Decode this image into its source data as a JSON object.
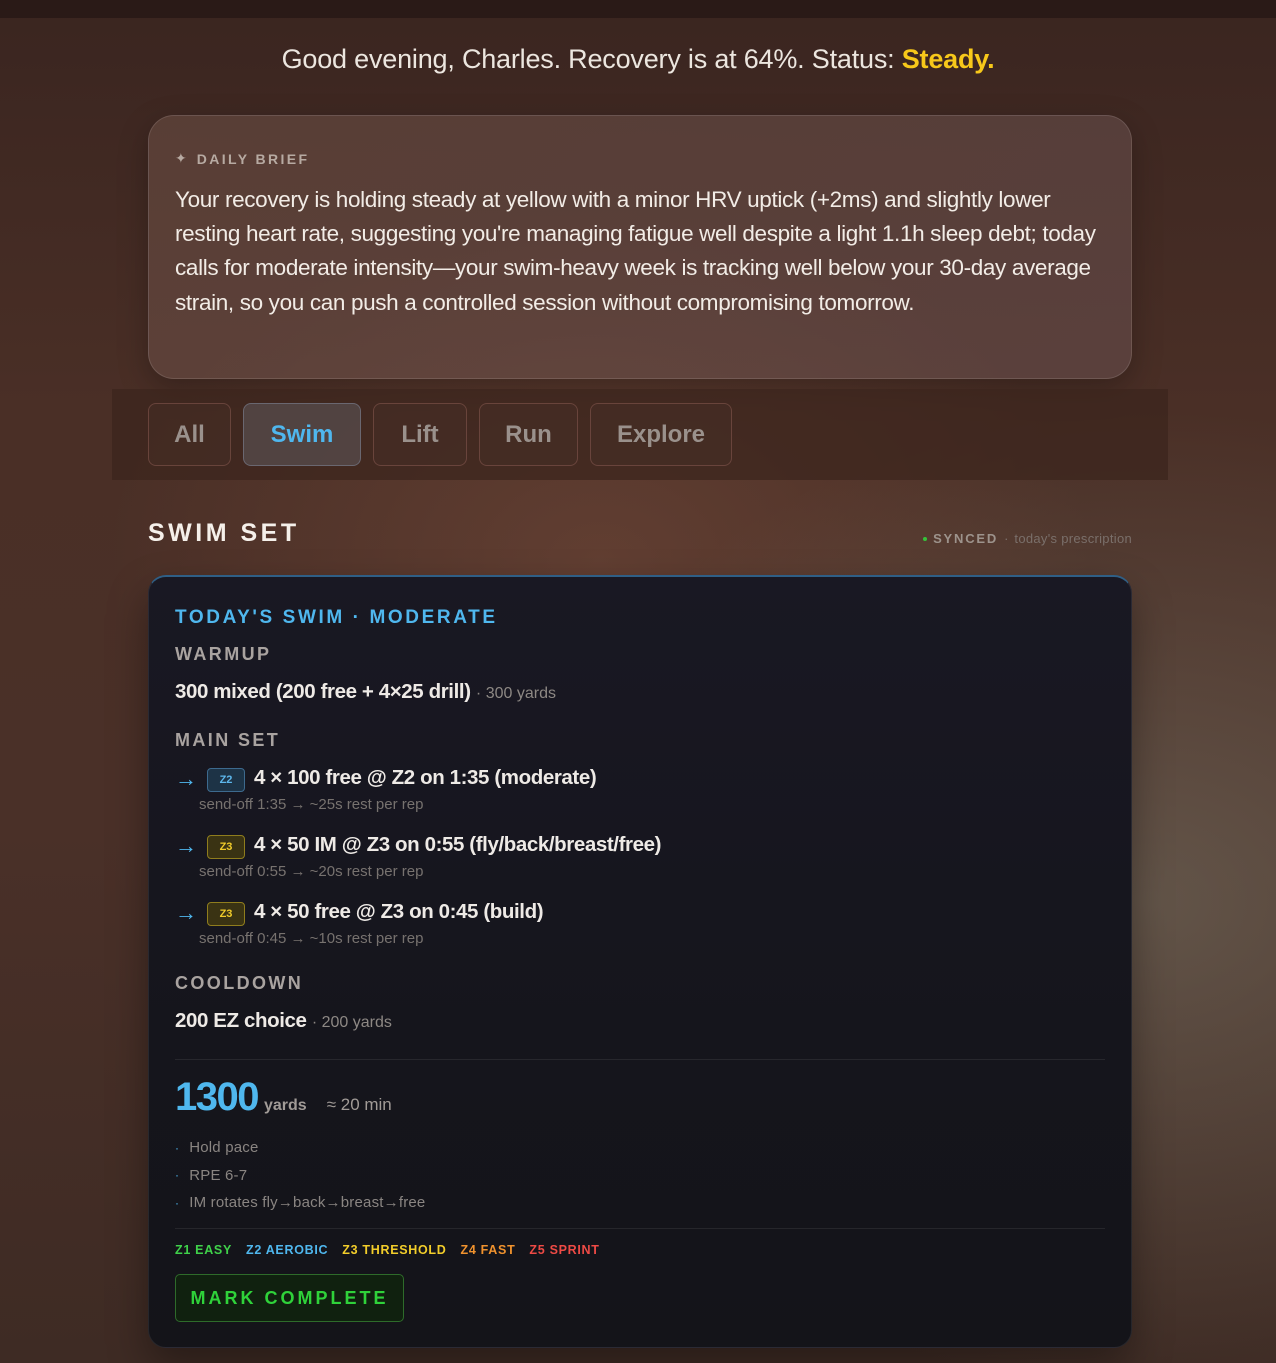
{
  "greeting": {
    "prefix": "Good evening, Charles. Recovery is at 64%. Status: ",
    "status": "Steady.",
    "status_color": "#f7c81a"
  },
  "brief": {
    "icon": "sparkle-icon",
    "heading": "DAILY BRIEF",
    "text": "Your recovery is holding steady at yellow with a minor HRV uptick (+2ms) and slightly lower resting heart rate, suggesting you're managing fatigue well despite a light 1.1h sleep debt; today calls for moderate intensity—your swim-heavy week is tracking well below your 30-day average strain, so you can push a controlled session without compromising tomorrow."
  },
  "tabs": [
    {
      "label": "All",
      "active": false
    },
    {
      "label": "Swim",
      "active": true
    },
    {
      "label": "Lift",
      "active": false
    },
    {
      "label": "Run",
      "active": false
    },
    {
      "label": "Explore",
      "active": false
    }
  ],
  "section": {
    "title": "SWIM SET",
    "sync_label": "SYNCED",
    "sync_sep": "·",
    "sync_sub": "today's prescription"
  },
  "workout": {
    "heading": "TODAY'S SWIM · MODERATE",
    "warmup": {
      "label": "WARMUP",
      "main": "300 mixed (200 free + 4×25 drill)",
      "sub": "· 300 yards"
    },
    "main_set": {
      "label": "MAIN SET",
      "reps": [
        {
          "zone": "Z2",
          "text": "4 × 100 free @ Z2 on 1:35 (moderate)",
          "hint": "send-off 1:35 → ~25s rest per rep"
        },
        {
          "zone": "Z3",
          "text": "4 × 50 IM @ Z3 on 0:55 (fly/back/breast/free)",
          "hint": "send-off 0:55 → ~20s rest per rep"
        },
        {
          "zone": "Z3",
          "text": "4 × 50 free @ Z3 on 0:45 (build)",
          "hint": "send-off 0:45 → ~10s rest per rep"
        }
      ]
    },
    "cooldown": {
      "label": "COOLDOWN",
      "main": "200 EZ choice",
      "sub": "· 200 yards"
    },
    "total": {
      "value": "1300",
      "unit": "yards",
      "duration": "≈ 20 min"
    },
    "notes": [
      "Hold pace",
      "RPE 6-7",
      "IM rotates fly→back→breast→free"
    ],
    "legend": [
      {
        "label": "Z1 EASY",
        "color": "#3fd14a"
      },
      {
        "label": "Z2 AEROBIC",
        "color": "#4fb7ee"
      },
      {
        "label": "Z3 THRESHOLD",
        "color": "#f2cd2a"
      },
      {
        "label": "Z4 FAST",
        "color": "#f0922e"
      },
      {
        "label": "Z5 SPRINT",
        "color": "#ee4a45"
      }
    ],
    "complete_label": "MARK COMPLETE"
  }
}
